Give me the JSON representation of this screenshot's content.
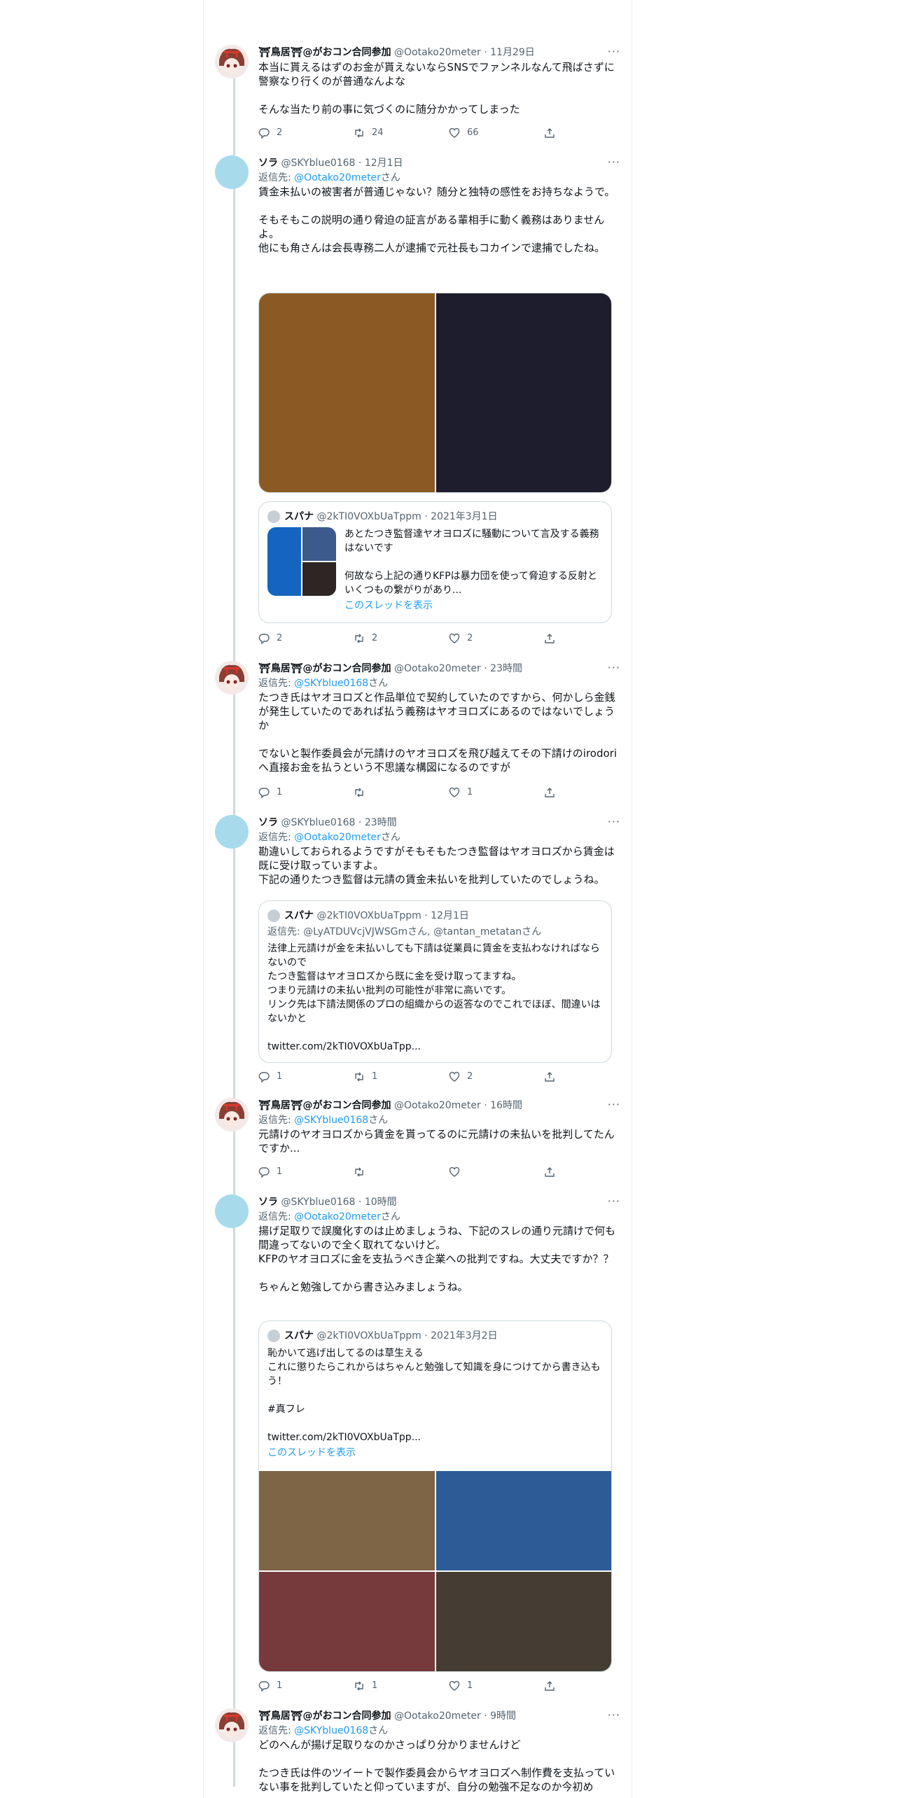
{
  "users": {
    "torii": {
      "name": "⛩鳥居⛩@がおコン合同参加",
      "handle": "@Ootako20meter"
    },
    "sora": {
      "name": "ソラ",
      "handle": "@SKYblue0168"
    },
    "supana": {
      "name": "スパナ",
      "handle": "@2kTI0VOXbUaTppm"
    }
  },
  "ui": {
    "dot": "·",
    "more": "···",
    "reply_prefix": "返信先:",
    "reply_suffix": "さん"
  },
  "icons": {
    "reply": "reply-icon",
    "retweet": "retweet-icon",
    "like": "heart-icon",
    "share": "share-icon"
  },
  "tweets": [
    {
      "time": "11月29日",
      "text": "本当に貰えるはずのお金が貰えないならSNSでファンネルなんて飛ばさずに警察なり行くのが普通なんよな\n\nそんな当たり前の事に気づくのに随分かかってしまった",
      "counts": {
        "reply": "2",
        "retweet": "24",
        "like": "66"
      }
    },
    {
      "time": "12月1日",
      "reply_to": "@Ootako20meter",
      "text": "賃金未払いの被害者が普通じゃない？随分と独特の感性をお持ちなようで。\n\nそもそもこの説明の通り脅迫の証言がある輩相手に動く義務はありませんよ。\n他にも角さんは会長専務二人が逮捕で元社長もコカインで逮捕でしたね。",
      "quote": {
        "time": "2021年3月1日",
        "text": "あとたつき監督達ヤオヨロズに騒動について言及する義務はないです\n\n何故なら上記の通りKFPは暴力団を使って脅迫する反射といくつもの繋がりがあり...",
        "thread": "このスレッドを表示"
      },
      "counts": {
        "reply": "2",
        "retweet": "2",
        "like": "2"
      }
    },
    {
      "time": "23時間",
      "reply_to": "@SKYblue0168",
      "text": "たつき氏はヤオヨロズと作品単位で契約していたのですから、何かしら金銭が発生していたのであれば払う義務はヤオヨロズにあるのではないでしょうか\n\nでないと製作委員会が元請けのヤオヨロズを飛び越えてその下請けのirodoriへ直接お金を払うという不思議な構図になるのですが",
      "counts": {
        "reply": "1",
        "retweet": "",
        "like": "1"
      }
    },
    {
      "time": "23時間",
      "reply_to": "@Ootako20meter",
      "text": "勘違いしておられるようですがそもそもたつき監督はヤオヨロズから賃金は既に受け取っていますよ。\n下記の通りたつき監督は元請の賃金未払いを批判していたのでしょうね。",
      "quote": {
        "time": "12月1日",
        "reply_to": "@LyATDUVcjVJWSGmさん, @tantan_metatanさん",
        "text": "法律上元請けが金を未払いしても下請は従業員に賃金を支払わなければならないので\nたつき監督はヤオヨロズから既に金を受け取ってますね。\nつまり元請けの未払い批判の可能性が非常に高いです。\nリンク先は下請法関係のプロの組織からの返答なのでこれでほぼ、間違いはないかと\n\ntwitter.com/2kTI0VOXbUaTpp..."
      },
      "counts": {
        "reply": "1",
        "retweet": "1",
        "like": "2"
      }
    },
    {
      "time": "16時間",
      "reply_to": "@SKYblue0168",
      "text": "元請けのヤオヨロズから賃金を貰ってるのに元請けの未払いを批判してたんですか...",
      "counts": {
        "reply": "1",
        "retweet": "",
        "like": ""
      }
    },
    {
      "time": "10時間",
      "reply_to": "@Ootako20meter",
      "text": "揚げ足取りで誤魔化すのは止めましょうね、下記のスレの通り元請けで何も間違ってないので全く取れてないけど。\nKFPのヤオヨロズに金を支払うべき企業への批判ですね。大丈夫ですか？？\n\nちゃんと勉強してから書き込みましょうね。",
      "quote": {
        "time": "2021年3月2日",
        "text": "恥かいて逃げ出してるのは草生える\nこれに懲りたらこれからはちゃんと勉強して知識を身につけてから書き込もう！\n\n#真フレ\n\ntwitter.com/2kTI0VOXbUaTpp...",
        "thread": "このスレッドを表示"
      },
      "counts": {
        "reply": "1",
        "retweet": "1",
        "like": "1"
      }
    },
    {
      "time": "9時間",
      "reply_to": "@SKYblue0168",
      "text": "どのへんが揚げ足取りなのかさっぱり分かりませんけど\n\nたつき氏は件のツイートで製作委員会からヤオヨロズへ制作費を支払っていない事を批判していたと仰っていますが、自分の勉強不足なのか今初め"
    }
  ]
}
